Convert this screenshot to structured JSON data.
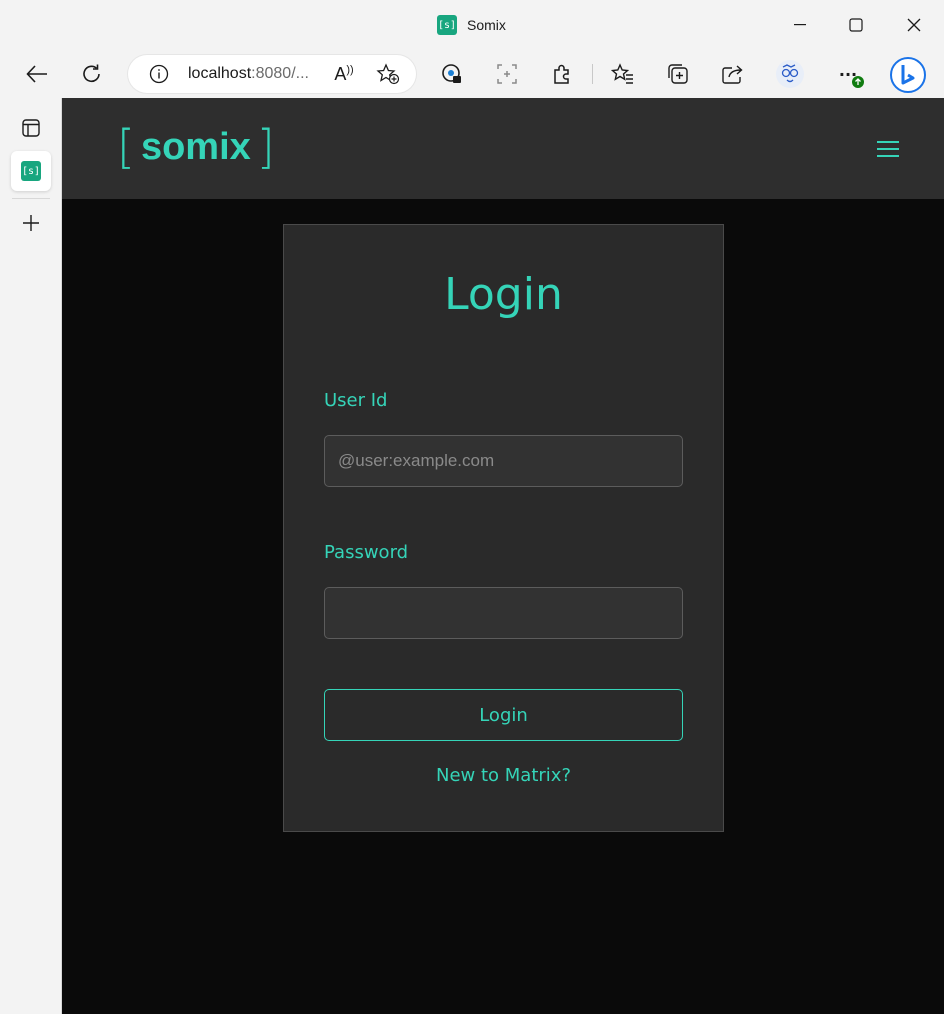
{
  "browser": {
    "tab_title": "Somix",
    "favicon_text": "[s]",
    "url_host": "localhost",
    "url_rest": ":8080/...",
    "read_aloud_label": "A",
    "more_label": "···",
    "icons": [
      "back-icon",
      "refresh-icon",
      "info-icon",
      "read-aloud-icon",
      "add-favorite-icon",
      "password-icon",
      "screenshot-icon",
      "extensions-icon",
      "favorites-icon",
      "collections-icon",
      "share-icon",
      "profile-icon",
      "more-icon",
      "bing-icon"
    ]
  },
  "sidebar": {
    "tab_favicon_text": "[s]",
    "icons": [
      "tab-actions-icon",
      "new-tab-icon"
    ]
  },
  "app": {
    "brand_open": "[",
    "brand_name": "somix",
    "brand_close": "]",
    "accent_color": "#35d4b8"
  },
  "login": {
    "title": "Login",
    "user_label": "User Id",
    "user_placeholder": "@user:example.com",
    "user_value": "",
    "password_label": "Password",
    "password_value": "",
    "submit_label": "Login",
    "register_link": "New to Matrix?"
  }
}
